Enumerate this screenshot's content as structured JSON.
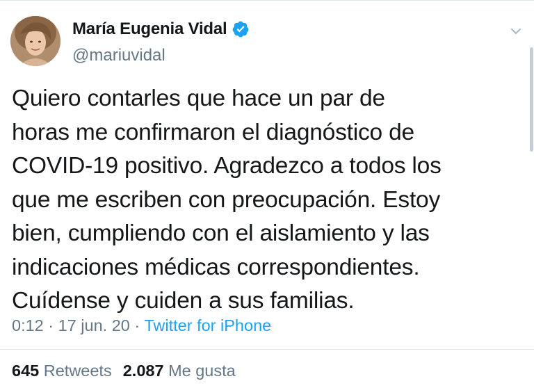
{
  "tweet": {
    "author": {
      "display_name": "María Eugenia Vidal",
      "handle": "@mariuvidal",
      "verified": true
    },
    "text_lines": [
      "Quiero contarles que hace un par de",
      "horas me confirmaron el diagnóstico de",
      "COVID-19 positivo. Agradezco a todos los",
      "que me escriben con preocupación. Estoy",
      "bien, cumpliendo con el aislamiento y las",
      "indicaciones médicas correspondientes.",
      "Cuídense y cuiden a sus familias."
    ],
    "meta": {
      "time": "0:12",
      "separator": "·",
      "date": "17 jun. 20",
      "source": "Twitter for iPhone"
    },
    "stats": {
      "retweets_count": "645",
      "retweets_label": "Retweets",
      "likes_count": "2.087",
      "likes_label": "Me gusta"
    }
  },
  "colors": {
    "text": "#14171a",
    "secondary": "#657786",
    "accent": "#1da1f2",
    "divider": "#e1e8ed"
  },
  "icons": {
    "verified": "verified-badge-icon",
    "caret": "chevron-down-icon"
  }
}
